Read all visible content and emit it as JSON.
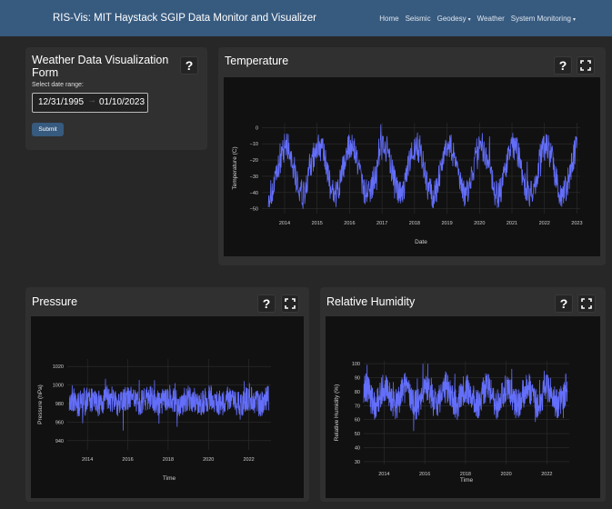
{
  "navbar": {
    "brand": "RIS-Vis: MIT Haystack SGIP Data Monitor and Visualizer",
    "links": [
      "Home",
      "Seismic",
      "Geodesy",
      "Weather",
      "System Monitoring"
    ],
    "caret": "▾"
  },
  "form": {
    "title_line1": "Weather Data Visualization",
    "title_line2": "Form",
    "help_label": "?",
    "range_label": "Select date range:",
    "start_date": "12/31/1995",
    "arrow": "→",
    "end_date": "01/10/2023",
    "submit_label": "Submit"
  },
  "panels": {
    "temperature": {
      "title": "Temperature",
      "help_label": "?"
    },
    "pressure": {
      "title": "Pressure",
      "help_label": "?"
    },
    "humidity": {
      "title": "Relative Humidity",
      "help_label": "?"
    }
  },
  "colors": {
    "navbar": "#375a7f",
    "series": "#636efa",
    "background": "#272727",
    "card": "#303030",
    "plot": "#111111"
  },
  "chart_data": [
    {
      "id": "temperature",
      "type": "line",
      "xlabel": "Date",
      "ylabel": "Temperature (C)",
      "xlim": [
        2013.3,
        2023.1
      ],
      "ylim": [
        -53,
        3
      ],
      "xticks": [
        "2014",
        "2015",
        "2016",
        "2017",
        "2018",
        "2019",
        "2020",
        "2021",
        "2022",
        "2023"
      ],
      "xtick_values": [
        2014,
        2015,
        2016,
        2017,
        2018,
        2019,
        2020,
        2021,
        2022,
        2023
      ],
      "yticks": [
        "0",
        "−10",
        "−20",
        "−30",
        "−40",
        "−50"
      ],
      "ytick_values": [
        0,
        -10,
        -20,
        -30,
        -40,
        -50
      ],
      "grid": true,
      "series": [
        {
          "x_start": 2013.5,
          "x_end": 2023.0,
          "mean": -26,
          "seasonal_amplitude": 15,
          "noise": 9,
          "min": -53,
          "max": 2
        }
      ]
    },
    {
      "id": "pressure",
      "type": "line",
      "xlabel": "Time",
      "ylabel": "Pressure (hPa)",
      "xlim": [
        2013.0,
        2023.1
      ],
      "ylim": [
        930,
        1028
      ],
      "xticks": [
        "2014",
        "2016",
        "2018",
        "2020",
        "2022"
      ],
      "xtick_values": [
        2014,
        2016,
        2018,
        2020,
        2022
      ],
      "yticks": [
        "1020",
        "1000",
        "980",
        "960",
        "940"
      ],
      "ytick_values": [
        1020,
        1000,
        980,
        960,
        940
      ],
      "grid": true,
      "series": [
        {
          "x_start": 2013.1,
          "x_end": 2023.0,
          "mean": 983,
          "seasonal_amplitude": 3,
          "noise": 14,
          "min": 932,
          "max": 1012
        }
      ]
    },
    {
      "id": "humidity",
      "type": "line",
      "xlabel": "Time",
      "ylabel": "Relative Humidity (%)",
      "xlim": [
        2013.0,
        2023.1
      ],
      "ylim": [
        28,
        102
      ],
      "xticks": [
        "2014",
        "2016",
        "2018",
        "2020",
        "2022"
      ],
      "xtick_values": [
        2014,
        2016,
        2018,
        2020,
        2022
      ],
      "yticks": [
        "100",
        "90",
        "80",
        "70",
        "60",
        "50",
        "40",
        "30"
      ],
      "ytick_values": [
        100,
        90,
        80,
        70,
        60,
        50,
        40,
        30
      ],
      "grid": true,
      "series": [
        {
          "x_start": 2013.0,
          "x_end": 2023.0,
          "mean": 77,
          "seasonal_amplitude": 6,
          "noise": 11,
          "min": 30,
          "max": 100
        }
      ]
    }
  ]
}
